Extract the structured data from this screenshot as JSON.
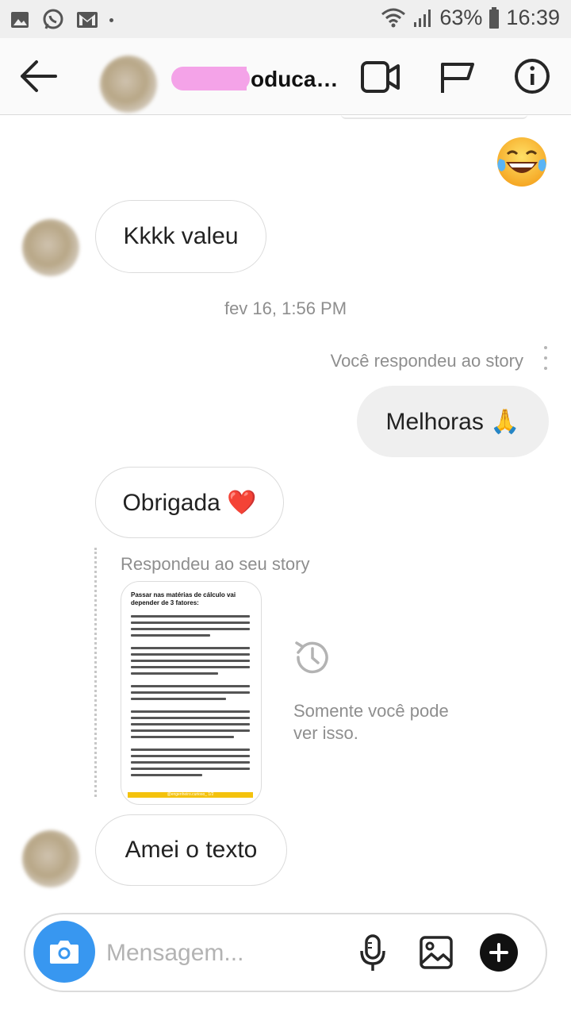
{
  "status_bar": {
    "battery_percent": "63%",
    "time": "16:39",
    "notification_icons": [
      "gallery-icon",
      "whatsapp-icon",
      "gmail-icon",
      "dot-icon"
    ],
    "system_icons": [
      "wifi-icon",
      "signal-icon",
      "battery-icon"
    ]
  },
  "header": {
    "title": "oduca…",
    "icons": [
      "back-arrow-icon",
      "video-call-icon",
      "flag-icon",
      "info-icon"
    ]
  },
  "messages": {
    "m1": "Kkkk valeu",
    "timestamp": "fev 16, 1:56 PM",
    "reply_meta_out": "Você respondeu ao story",
    "m2": "Melhoras 🙏",
    "m3": "Obrigada ❤️",
    "reply_meta_in": "Respondeu ao seu story",
    "only_you": "Somente você pode ver isso.",
    "m4": "Amei o texto"
  },
  "story_preview": {
    "title": "Passar nas matérias de cálculo vai depender de 3 fatores:",
    "footer": "@engenheiro.curioso_ 1/2"
  },
  "composer": {
    "placeholder": "Mensagem..."
  },
  "colors": {
    "accent_blue": "#3897f0",
    "bubble_out": "#efefef",
    "border": "#dbdbdb",
    "meta_text": "#8e8e8e",
    "story_footer": "#f4c20d"
  }
}
